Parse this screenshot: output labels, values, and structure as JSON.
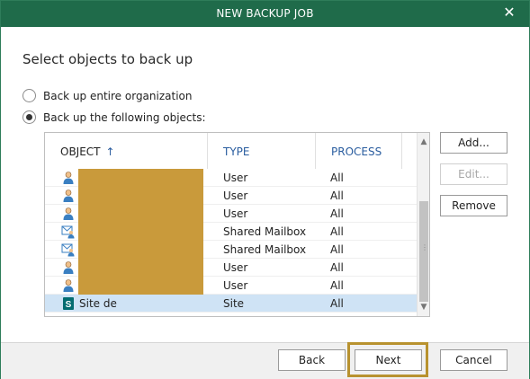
{
  "window": {
    "title": "NEW BACKUP JOB",
    "close_glyph": "✕"
  },
  "heading": "Select objects to back up",
  "options": {
    "entire_org": "Back up entire organization",
    "following": "Back up the following objects:"
  },
  "table": {
    "columns": {
      "object": "OBJECT",
      "type": "TYPE",
      "process": "PROCESS",
      "sort_glyph": "↑"
    },
    "rows": [
      {
        "icon": "user-icon",
        "name": "",
        "type": "User",
        "process": "All"
      },
      {
        "icon": "user-icon",
        "name": "",
        "type": "User",
        "process": "All"
      },
      {
        "icon": "user-icon",
        "name": "",
        "type": "User",
        "process": "All"
      },
      {
        "icon": "shared-mailbox-icon",
        "name": "",
        "type": "Shared Mailbox",
        "process": "All"
      },
      {
        "icon": "shared-mailbox-icon",
        "name": "",
        "type": "Shared Mailbox",
        "process": "All"
      },
      {
        "icon": "user-icon",
        "name": "",
        "type": "User",
        "process": "All"
      },
      {
        "icon": "user-icon",
        "name": "",
        "type": "User",
        "process": "All"
      },
      {
        "icon": "sharepoint-site-icon",
        "name": "Site de communication",
        "type": "Site",
        "process": "All"
      }
    ]
  },
  "side_buttons": {
    "add": "Add...",
    "edit": "Edit...",
    "remove": "Remove"
  },
  "footer": {
    "back": "Back",
    "next": "Next",
    "cancel": "Cancel"
  },
  "colors": {
    "titlebar": "#1f6b4a",
    "accent_link": "#2a5d9f",
    "selection": "#cfe3f5",
    "highlight_outline": "#b8922f",
    "redaction": "#c99a3b"
  }
}
